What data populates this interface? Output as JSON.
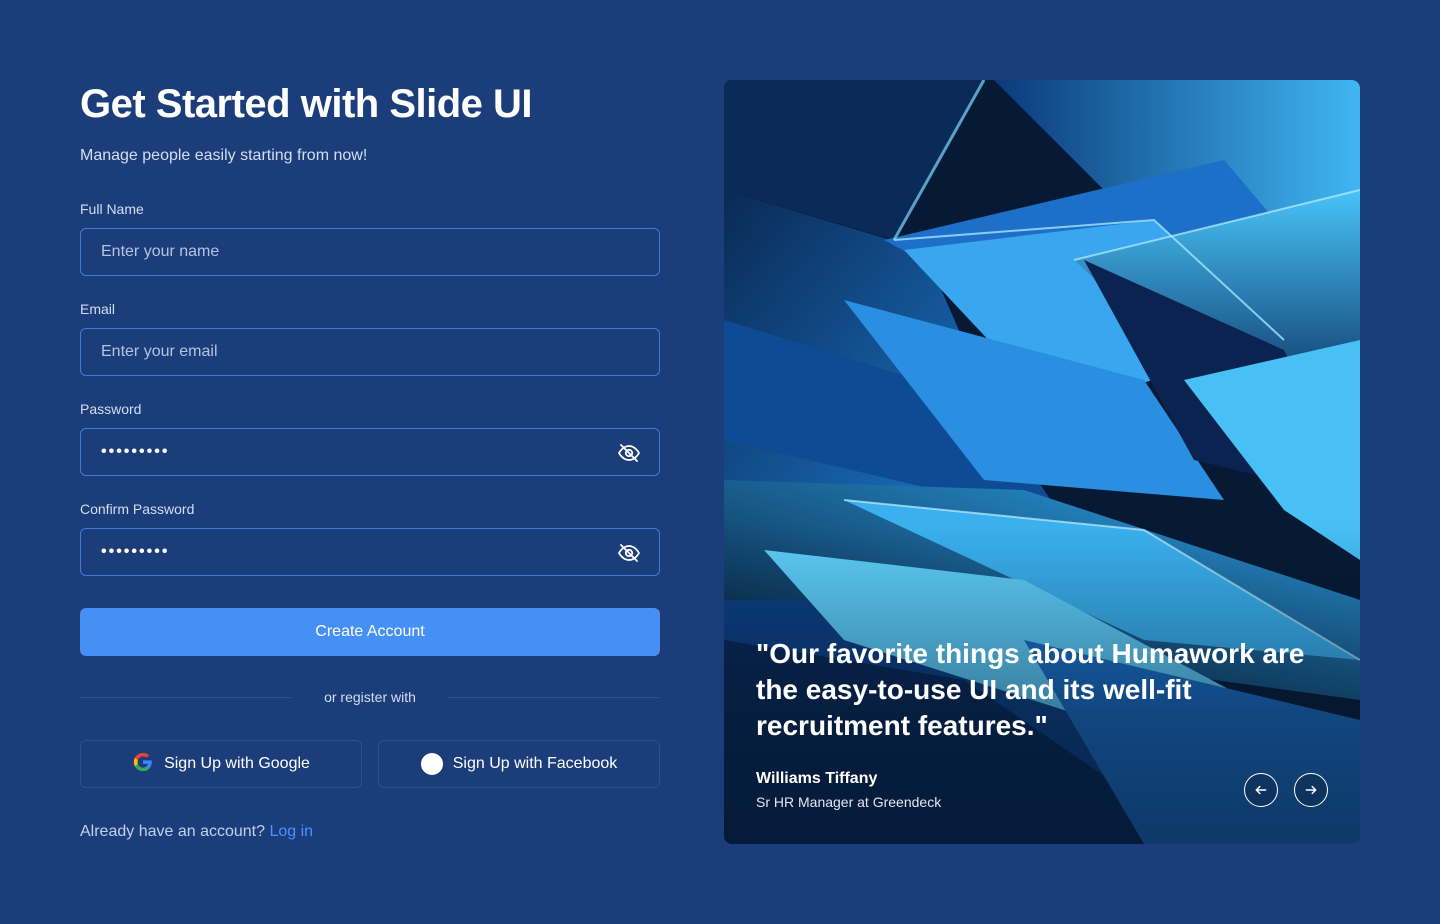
{
  "header": {
    "title": "Get Started with Slide UI",
    "subtitle": "Manage people easily starting from now!"
  },
  "form": {
    "full_name": {
      "label": "Full Name",
      "placeholder": "Enter your name"
    },
    "email": {
      "label": "Email",
      "placeholder": "Enter your email"
    },
    "password": {
      "label": "Password",
      "masked_value": "•••••••••"
    },
    "confirm_password": {
      "label": "Confirm Password",
      "masked_value": "•••••••••"
    },
    "submit_label": "Create Account"
  },
  "social": {
    "divider_text": "or register with",
    "google_label": "Sign Up with Google",
    "facebook_label": "Sign Up with Facebook"
  },
  "footer": {
    "prompt": "Already have an account?",
    "login_label": "Log in"
  },
  "testimonial": {
    "quote": "\"Our favorite things about Humawork are the easy-to-use UI and its well-fit recruitment features.\"",
    "author": "Williams Tiffany",
    "role": "Sr HR Manager at Greendeck"
  },
  "icons": {
    "password_toggle": "eye-off-icon",
    "confirm_toggle": "eye-off-icon",
    "google": "google-icon",
    "facebook": "facebook-icon",
    "prev": "arrow-left-icon",
    "next": "arrow-right-icon"
  },
  "colors": {
    "background": "#1b3d7a",
    "accent": "#4590f5",
    "field_border": "#3f7ad6",
    "link": "#4b93ff"
  }
}
